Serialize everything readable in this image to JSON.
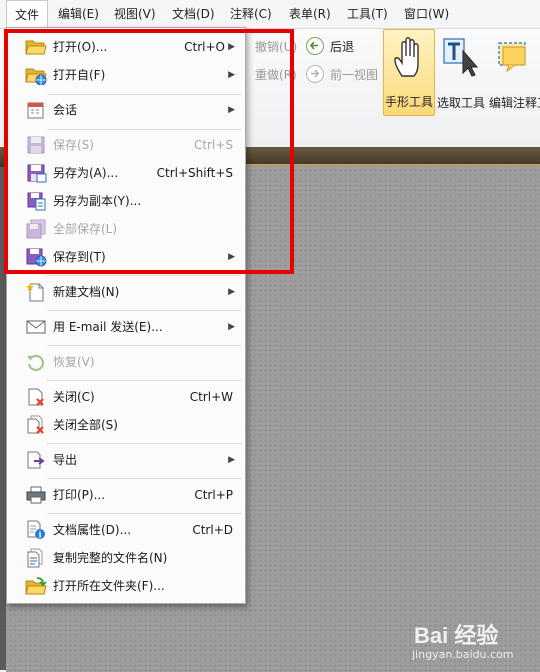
{
  "menubar": {
    "items": [
      {
        "label": "文件"
      },
      {
        "label": "编辑(E)"
      },
      {
        "label": "视图(V)"
      },
      {
        "label": "文档(D)"
      },
      {
        "label": "注释(C)"
      },
      {
        "label": "表单(R)"
      },
      {
        "label": "工具(T)"
      },
      {
        "label": "窗口(W)"
      }
    ]
  },
  "ribbon": {
    "undo": "撤销(U)",
    "redo": "重做(R)",
    "back": "后退",
    "forward": "前一视图",
    "hand_tool": "手形工具",
    "select_tool": "选取工具",
    "edit_annot": "编辑注释工"
  },
  "file_menu": {
    "items": [
      {
        "label": "打开(O)...",
        "shortcut": "Ctrl+O",
        "icon": "folder-open-icon"
      },
      {
        "label": "打开自(F)",
        "icon": "folder-web-icon"
      },
      {
        "label": "会话",
        "icon": "calendar-icon"
      },
      {
        "label": "保存(S)",
        "shortcut": "Ctrl+S",
        "icon": "save-icon"
      },
      {
        "label": "另存为(A)...",
        "shortcut": "Ctrl+Shift+S",
        "icon": "save-as-icon"
      },
      {
        "label": "另存为副本(Y)...",
        "icon": "save-copy-icon"
      },
      {
        "label": "全部保存(L)",
        "icon": "save-all-icon"
      },
      {
        "label": "保存到(T)",
        "icon": "save-to-icon"
      },
      {
        "label": "新建文档(N)",
        "icon": "new-document-icon"
      },
      {
        "label": "用 E-mail 发送(E)...",
        "icon": "email-icon"
      },
      {
        "label": "恢复(V)",
        "icon": "revert-icon"
      },
      {
        "label": "关闭(C)",
        "shortcut": "Ctrl+W",
        "icon": "close-document-icon"
      },
      {
        "label": "关闭全部(S)",
        "icon": "close-all-icon"
      },
      {
        "label": "导出",
        "icon": "export-icon"
      },
      {
        "label": "打印(P)...",
        "shortcut": "Ctrl+P",
        "icon": "printer-icon"
      },
      {
        "label": "文档属性(D)...",
        "shortcut": "Ctrl+D",
        "icon": "document-properties-icon"
      },
      {
        "label": "复制完整的文件名(N)",
        "icon": "copy-filename-icon"
      },
      {
        "label": "打开所在文件夹(F)...",
        "icon": "open-folder-icon"
      }
    ]
  },
  "watermark": {
    "line1": "Bai 经验",
    "line2": "jingyan.baidu.com"
  }
}
